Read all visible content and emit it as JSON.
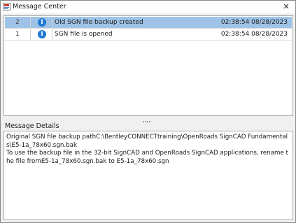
{
  "window": {
    "title": "Message Center",
    "close_label": "✕"
  },
  "messages": [
    {
      "number": "2",
      "icon": "info-icon",
      "text": "Old SGN file backup created",
      "time": "02:38:54 08/28/2023",
      "selected": true
    },
    {
      "number": "1",
      "icon": "info-icon",
      "text": "SGN file is opened",
      "time": "02:38:54 08/28/2023",
      "selected": false
    }
  ],
  "details": {
    "label": "Message Details",
    "lines": [
      "Original SGN file backup pathC:\\BentleyCONNECTtraining\\OpenRoads SignCAD Fundamentals\\E5-1a_78x60.sgn.bak",
      "To use the backup file in the 32-bit SignCAD and OpenRoads SignCAD applications, rename the file fromE5-1a_78x60.sgn.bak to E5-1a_78x60.sgn"
    ]
  },
  "colors": {
    "selected_row": "#9fc3e7",
    "info_icon": "#1f78d1"
  }
}
